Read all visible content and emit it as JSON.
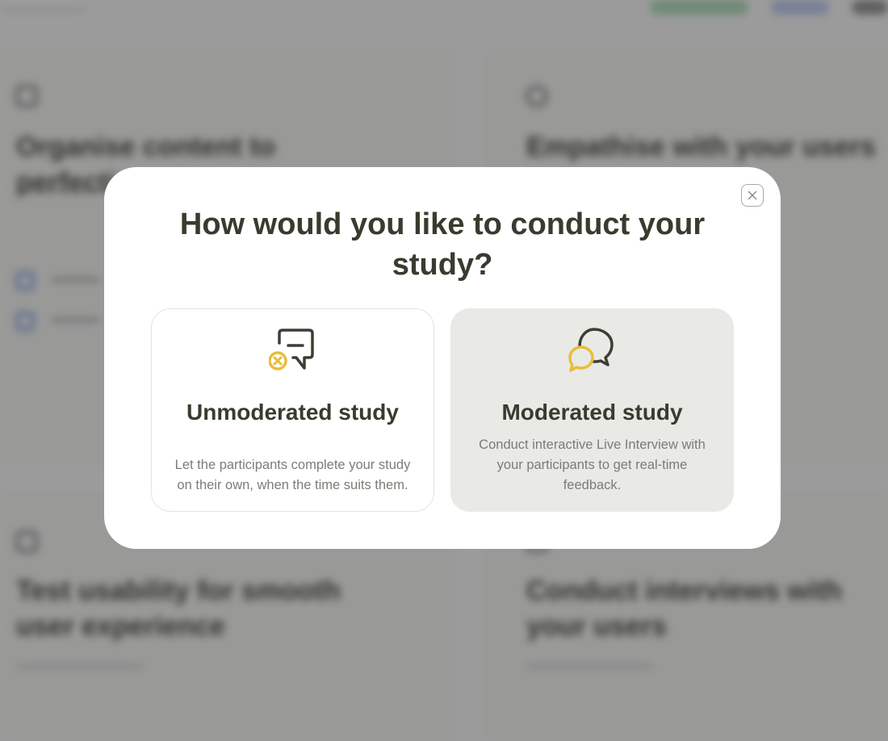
{
  "modal": {
    "title": "How would you like to conduct your study?",
    "close_icon": "close-icon",
    "options": [
      {
        "title": "Unmoderated study",
        "description": "Let the participants complete your study on their own, when the time suits them.",
        "icon": "chat-bubble-dismiss-icon"
      },
      {
        "title": "Moderated study",
        "description": "Conduct interactive Live Interview with your participants to get real-time feedback.",
        "icon": "conversation-bubbles-icon"
      }
    ]
  },
  "background": {
    "cards": [
      {
        "title": "Organise content to perfection"
      },
      {
        "title": "Empathise with your users"
      },
      {
        "title": "Test usability for smooth user experience"
      },
      {
        "title": "Conduct interviews with your users"
      }
    ]
  },
  "colors": {
    "accent": "#e8bd3a",
    "text_dark": "#3a3a2e",
    "selected_option_bg": "#e9e9e6"
  }
}
